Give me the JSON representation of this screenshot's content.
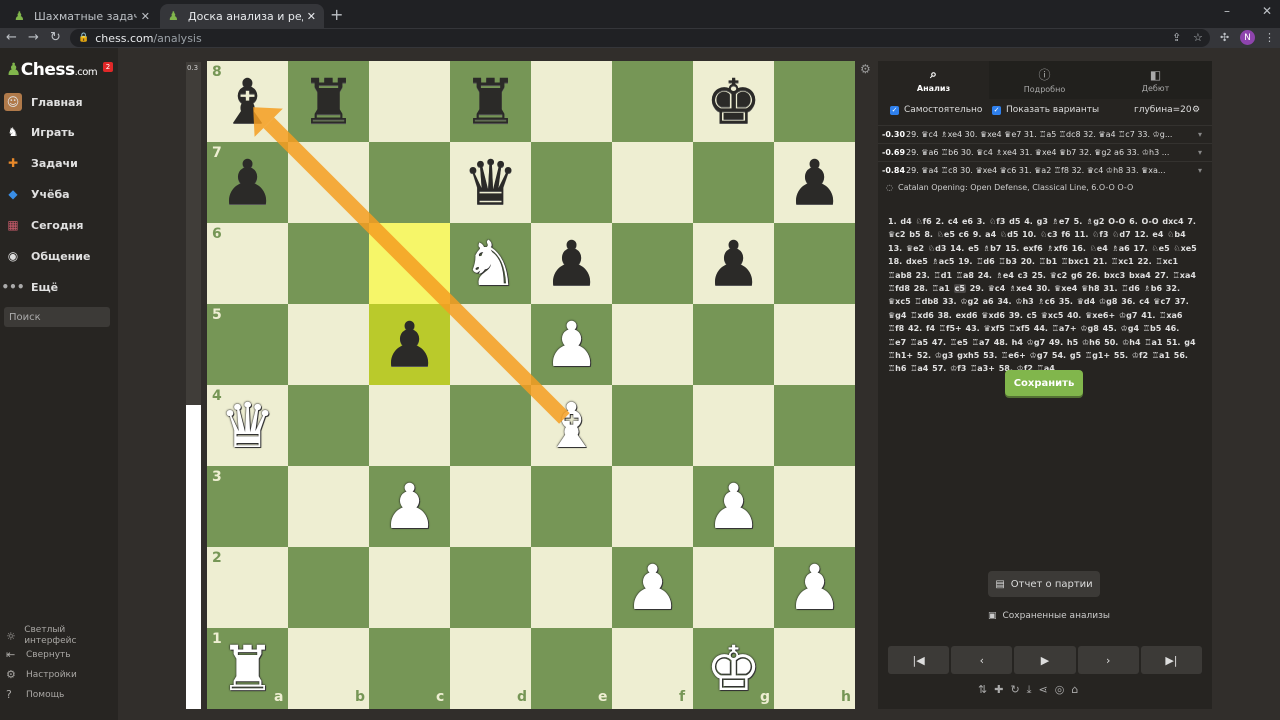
{
  "browser": {
    "tabs": [
      {
        "title": "Шахматные задачи - соверше",
        "active": false
      },
      {
        "title": "Доска анализа и редактор PG",
        "active": true
      }
    ],
    "url_host": "chess.com",
    "url_path": "/analysis",
    "profile_initial": "N"
  },
  "sidebar": {
    "logo": "Chess",
    "logo_suffix": ".com",
    "notif_count": "2",
    "items": [
      {
        "label": "Главная"
      },
      {
        "label": "Играть"
      },
      {
        "label": "Задачи"
      },
      {
        "label": "Учёба"
      },
      {
        "label": "Сегодня"
      },
      {
        "label": "Общение"
      },
      {
        "label": "Ещё"
      }
    ],
    "search_placeholder": "Поиск",
    "footer": [
      {
        "label": "Светлый интерфейс"
      },
      {
        "label": "Свернуть"
      },
      {
        "label": "Настройки"
      },
      {
        "label": "Помощь"
      }
    ]
  },
  "eval_bar": {
    "label": "0.3",
    "white_fraction": 0.47
  },
  "board": {
    "ranks": [
      "8",
      "7",
      "6",
      "5",
      "4",
      "3",
      "2",
      "1"
    ],
    "files": [
      "a",
      "b",
      "c",
      "d",
      "e",
      "f",
      "g",
      "h"
    ],
    "highlight": [
      "c6",
      "c5"
    ],
    "pieces": [
      {
        "sq": "a8",
        "p": "♝",
        "c": "b"
      },
      {
        "sq": "b8",
        "p": "♜",
        "c": "b"
      },
      {
        "sq": "d8",
        "p": "♜",
        "c": "b"
      },
      {
        "sq": "g8",
        "p": "♚",
        "c": "b"
      },
      {
        "sq": "a7",
        "p": "♟",
        "c": "b"
      },
      {
        "sq": "d7",
        "p": "♛",
        "c": "b"
      },
      {
        "sq": "h7",
        "p": "♟",
        "c": "b"
      },
      {
        "sq": "d6",
        "p": "♞",
        "c": "w"
      },
      {
        "sq": "e6",
        "p": "♟",
        "c": "b"
      },
      {
        "sq": "g6",
        "p": "♟",
        "c": "b"
      },
      {
        "sq": "c5",
        "p": "♟",
        "c": "b"
      },
      {
        "sq": "e5",
        "p": "♟",
        "c": "w"
      },
      {
        "sq": "a4",
        "p": "♛",
        "c": "w"
      },
      {
        "sq": "e4",
        "p": "♝",
        "c": "w"
      },
      {
        "sq": "c3",
        "p": "♟",
        "c": "w"
      },
      {
        "sq": "g3",
        "p": "♟",
        "c": "w"
      },
      {
        "sq": "f2",
        "p": "♟",
        "c": "w"
      },
      {
        "sq": "h2",
        "p": "♟",
        "c": "w"
      },
      {
        "sq": "a1",
        "p": "♜",
        "c": "w"
      },
      {
        "sq": "g1",
        "p": "♚",
        "c": "w"
      }
    ],
    "arrow": {
      "from": "e4",
      "to": "a8"
    }
  },
  "panel": {
    "tabs": [
      {
        "label": "Анализ"
      },
      {
        "label": "Подробно"
      },
      {
        "label": "Дебют"
      }
    ],
    "opt_self": "Самостоятельно",
    "opt_variants": "Показать варианты",
    "depth": "глубина=20",
    "lines": [
      {
        "score": "-0.30",
        "moves": "29. ♛c4 ♗xe4 30. ♛xe4 ♛e7 31. ♖a5 ♖dc8 32. ♛a4 ♖c7 33. ♔g..."
      },
      {
        "score": "-0.69",
        "moves": "29. ♛a6 ♖b6 30. ♛c4 ♗xe4 31. ♛xe4 ♛b7 32. ♛g2 a6 33. ♔h3 ..."
      },
      {
        "score": "-0.84",
        "moves": "29. ♛a4 ♖c8 30. ♛xe4 ♛c6 31. ♛a2 ♖f8 32. ♛c4 ♔h8 33. ♛xa..."
      }
    ],
    "opening": "Catalan Opening: Open Defense, Classical Line, 6.O-O O-O",
    "pgn_before": "1. d4 ♘f6 2. c4 e6 3. ♘f3 d5 4. g3 ♗e7 5. ♗g2 O-O 6. O-O dxc4 7. ♛c2 b5 8. ♘e5 c6 9. a4 ♘d5 10. ♘c3 f6 11. ♘f3 ♘d7 12. e4 ♘b4 13. ♛e2 ♘d3 14. e5 ♗b7 15. exf6 ♗xf6 16. ♘e4 ♗a6 17. ♘e5 ♘xe5 18. dxe5 ♗ac5 19. ♖d6 ♖b3 20. ♖b1 ♖bxc1 21. ♖xc1 22. ♖xc1 ♖ab8 23. ♖d1 ♖a8 24. ♗e4 c3 25. ♛c2 g6 26. bxc3 bxa4 27. ♖xa4 ♖fd8 28. ♖a1",
    "pgn_current": "c5",
    "pgn_after": "29. ♛c4 ♗xe4 30. ♛xe4 ♛h8 31. ♖d6 ♗b6 32. ♛xc5 ♖db8 33. ♔g2 a6 34. ♔h3 ♗c6 35. ♛d4 ♔g8 36. c4 ♛c7 37. ♛g4 ♖xd6 38. exd6 ♛xd6 39. c5 ♛xc5 40. ♛xe6+ ♔g7 41. ♖xa6 ♖f8 42. f4 ♖f5+ 43. ♛xf5 ♖xf5 44. ♖a7+ ♔g8 45. ♔g4 ♖b5 46. ♖e7 ♖a5 47. ♖e5 ♖a7 48. h4 ♔g7 49. h5 ♔h6 50. ♔h4 ♖a1 51. g4 ♖h1+ 52. ♔g3 gxh5 53. ♖e6+ ♔g7 54. g5 ♖g1+ 55. ♔f2 ♖a1 56. ♖h6 ♖a4 57. ♔f3 ♖a3+ 58. ♔f2 ♖a4",
    "save_label": "Сохранить",
    "report_label": "Отчет о партии",
    "saved_label": "Сохраненные анализы"
  }
}
